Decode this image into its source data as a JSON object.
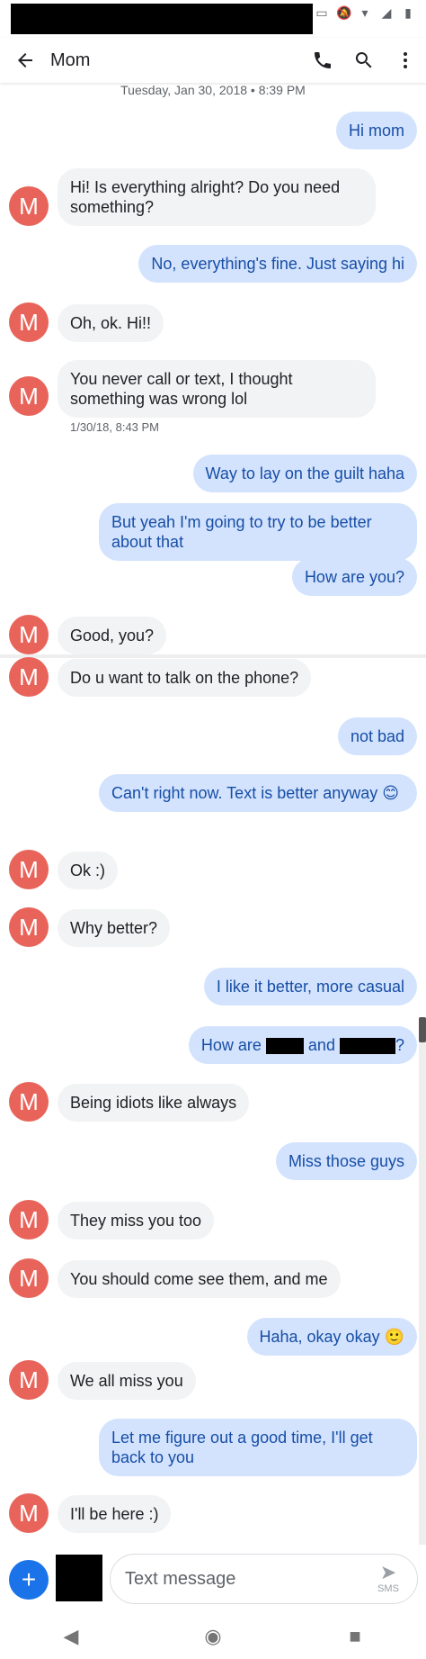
{
  "header": {
    "title": "Mom"
  },
  "timestamps": {
    "top": "Tuesday, Jan 30, 2018 • 8:39 PM",
    "after_msg_6": "1/30/18, 8:43 PM"
  },
  "contact": {
    "avatar_letter": "M"
  },
  "messages": [
    {
      "dir": "out",
      "text": "Hi mom"
    },
    {
      "dir": "in",
      "text": "Hi! Is everything alright? Do you need something?"
    },
    {
      "dir": "out",
      "text": "No, everything's fine. Just saying hi"
    },
    {
      "dir": "in",
      "text": "Oh, ok. Hi!!"
    },
    {
      "dir": "in",
      "text": "You never call or text, I thought something was wrong lol"
    },
    {
      "dir": "out",
      "text": "Way to lay on the guilt haha"
    },
    {
      "dir": "out",
      "text": "But yeah I'm going to try to be better about that"
    },
    {
      "dir": "out",
      "text": "How are you?"
    },
    {
      "dir": "in",
      "text": "Good, you?"
    },
    {
      "dir": "in",
      "text": "Do u want to talk on the phone?"
    },
    {
      "dir": "out",
      "text": "not bad"
    },
    {
      "dir": "out",
      "text": "Can't right now. Text is better anyway 😊"
    },
    {
      "dir": "in",
      "text": "Ok :)"
    },
    {
      "dir": "in",
      "text": "Why better?"
    },
    {
      "dir": "out",
      "text": "I like it better, more casual"
    },
    {
      "dir": "out",
      "text_parts": [
        "How are",
        "and",
        "?"
      ]
    },
    {
      "dir": "in",
      "text": "Being idiots like always"
    },
    {
      "dir": "out",
      "text": "Miss those guys"
    },
    {
      "dir": "in",
      "text": "They miss you too"
    },
    {
      "dir": "in",
      "text": "You should come see them, and me"
    },
    {
      "dir": "out",
      "text": "Haha, okay okay 🙂"
    },
    {
      "dir": "in",
      "text": "We all miss you"
    },
    {
      "dir": "out",
      "text": "Let me figure out a good time, I'll get back to you"
    },
    {
      "dir": "in",
      "text": "I'll be here :)"
    }
  ],
  "composer": {
    "add_symbol": "+",
    "placeholder": "Text message",
    "send_label": "SMS",
    "send_icon": "send-icon"
  },
  "icons": {
    "back": "arrow-back-icon",
    "call": "phone-icon",
    "search": "search-icon",
    "more": "more-vert-icon"
  },
  "colors": {
    "avatar": "#e8645a",
    "incoming_bubble": "#f1f3f4",
    "outgoing_bubble": "#d3e3fd",
    "outgoing_text": "#174ea6",
    "add_button": "#1a73e8"
  }
}
